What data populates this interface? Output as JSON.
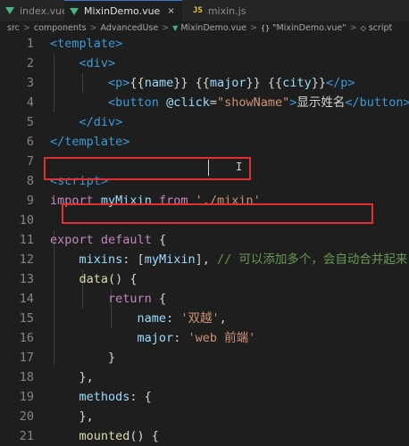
{
  "tabs": [
    {
      "label": "index.vue",
      "icon": "vue-icon",
      "active": false
    },
    {
      "label": "MixinDemo.vue",
      "icon": "vue-icon",
      "active": true,
      "close": "×"
    },
    {
      "label": "mixin.js",
      "icon": "js-icon",
      "icon_text": "JS",
      "active": false
    }
  ],
  "breadcrumb": [
    "src",
    "components",
    "AdvancedUse",
    "MixinDemo.vue",
    "\"MixinDemo.vue\"",
    "script"
  ],
  "breadcrumb_sep": ">",
  "brace_icon": "{}",
  "lines": [
    {
      "n": "1",
      "tokens": [
        [
          "tag",
          "<template>"
        ]
      ]
    },
    {
      "n": "2",
      "tokens": [
        [
          "txt",
          "    "
        ],
        [
          "tag",
          "<div>"
        ]
      ]
    },
    {
      "n": "3",
      "tokens": [
        [
          "txt",
          "        "
        ],
        [
          "tag",
          "<p>"
        ],
        [
          "mustache",
          "{{"
        ],
        [
          "var",
          "name"
        ],
        [
          "mustache",
          "}}"
        ],
        [
          "txt",
          " "
        ],
        [
          "mustache",
          "{{"
        ],
        [
          "var",
          "major"
        ],
        [
          "mustache",
          "}}"
        ],
        [
          "txt",
          " "
        ],
        [
          "mustache",
          "{{"
        ],
        [
          "var",
          "city"
        ],
        [
          "mustache",
          "}}"
        ],
        [
          "tag",
          "</p>"
        ]
      ]
    },
    {
      "n": "4",
      "tokens": [
        [
          "txt",
          "        "
        ],
        [
          "tag",
          "<button"
        ],
        [
          "txt",
          " "
        ],
        [
          "attr",
          "@click"
        ],
        [
          "txt",
          "="
        ],
        [
          "str",
          "\"showName\""
        ],
        [
          "tag",
          ">"
        ],
        [
          "txt",
          "显示姓名"
        ],
        [
          "tag",
          "</button>"
        ]
      ]
    },
    {
      "n": "5",
      "tokens": [
        [
          "txt",
          "    "
        ],
        [
          "tag",
          "</div>"
        ]
      ]
    },
    {
      "n": "6",
      "tokens": [
        [
          "tag",
          "</template>"
        ]
      ]
    },
    {
      "n": "7",
      "tokens": []
    },
    {
      "n": "8",
      "tokens": [
        [
          "tag",
          "<script>"
        ]
      ]
    },
    {
      "n": "9",
      "tokens": [
        [
          "kw",
          "import"
        ],
        [
          "txt",
          " "
        ],
        [
          "var",
          "myMixin"
        ],
        [
          "txt",
          " "
        ],
        [
          "kw",
          "from"
        ],
        [
          "txt",
          " "
        ],
        [
          "str",
          "'./mixin'"
        ]
      ]
    },
    {
      "n": "10",
      "tokens": []
    },
    {
      "n": "11",
      "tokens": [
        [
          "kw",
          "export"
        ],
        [
          "txt",
          " "
        ],
        [
          "kw",
          "default"
        ],
        [
          "txt",
          " {"
        ]
      ]
    },
    {
      "n": "12",
      "tokens": [
        [
          "txt",
          "    "
        ],
        [
          "var",
          "mixins"
        ],
        [
          "txt",
          ": ["
        ],
        [
          "var",
          "myMixin"
        ],
        [
          "txt",
          "], "
        ],
        [
          "cmt",
          "// 可以添加多个，会自动合并起来"
        ]
      ]
    },
    {
      "n": "13",
      "tokens": [
        [
          "txt",
          "    "
        ],
        [
          "fn",
          "data"
        ],
        [
          "txt",
          "() {"
        ]
      ]
    },
    {
      "n": "14",
      "tokens": [
        [
          "txt",
          "        "
        ],
        [
          "kw",
          "return"
        ],
        [
          "txt",
          " {"
        ]
      ]
    },
    {
      "n": "15",
      "tokens": [
        [
          "txt",
          "            "
        ],
        [
          "var",
          "name"
        ],
        [
          "txt",
          ": "
        ],
        [
          "str",
          "'双越'"
        ],
        [
          "txt",
          ","
        ]
      ]
    },
    {
      "n": "16",
      "tokens": [
        [
          "txt",
          "            "
        ],
        [
          "var",
          "major"
        ],
        [
          "txt",
          ": "
        ],
        [
          "str",
          "'web 前端'"
        ]
      ]
    },
    {
      "n": "17",
      "tokens": [
        [
          "txt",
          "        }"
        ]
      ]
    },
    {
      "n": "18",
      "tokens": [
        [
          "txt",
          "    },"
        ]
      ]
    },
    {
      "n": "19",
      "tokens": [
        [
          "txt",
          "    "
        ],
        [
          "var",
          "methods"
        ],
        [
          "txt",
          ": {"
        ]
      ]
    },
    {
      "n": "20",
      "tokens": [
        [
          "txt",
          "    },"
        ]
      ]
    },
    {
      "n": "21",
      "tokens": [
        [
          "txt",
          "    "
        ],
        [
          "fn",
          "mounted"
        ],
        [
          "txt",
          "() {"
        ]
      ]
    }
  ]
}
